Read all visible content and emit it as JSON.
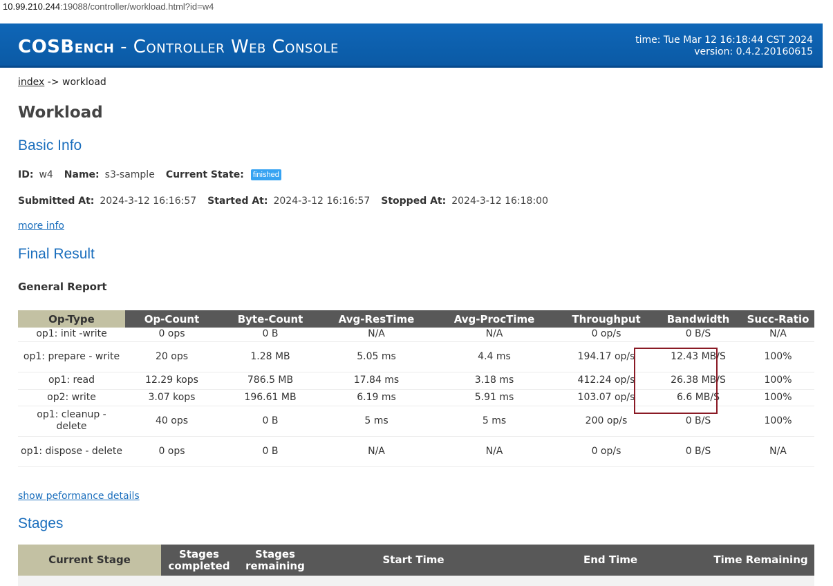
{
  "address_bar": {
    "host": "10.99.210.244",
    "rest": ":19088/controller/workload.html?id=w4"
  },
  "header": {
    "brand_bold": "COSBench",
    "brand_rest": " - Controller Web Console",
    "time": "time: Tue Mar 12 16:18:44 CST 2024",
    "version": "version: 0.4.2.20160615"
  },
  "breadcrumb": {
    "index": "index",
    "separator": " -> ",
    "current": "workload"
  },
  "page_title": "Workload",
  "basic_info": {
    "heading": "Basic Info",
    "id_label": "ID:",
    "id_value": "w4",
    "name_label": "Name:",
    "name_value": "s3-sample",
    "state_label": "Current State:",
    "state_value": "finished",
    "submitted_label": "Submitted At:",
    "submitted_value": "2024-3-12 16:16:57",
    "started_label": "Started At:",
    "started_value": "2024-3-12 16:16:57",
    "stopped_label": "Stopped At:",
    "stopped_value": "2024-3-12 16:18:00",
    "more_info": "more info"
  },
  "final_result": {
    "heading": "Final Result",
    "report_title": "General Report",
    "columns": [
      "Op-Type",
      "Op-Count",
      "Byte-Count",
      "Avg-ResTime",
      "Avg-ProcTime",
      "Throughput",
      "Bandwidth",
      "Succ-Ratio"
    ],
    "rows": [
      [
        "op1: init -write",
        "0 ops",
        "0 B",
        "N/A",
        "N/A",
        "0 op/s",
        "0 B/S",
        "N/A"
      ],
      [
        "op1: prepare - write",
        "20 ops",
        "1.28 MB",
        "5.05 ms",
        "4.4 ms",
        "194.17 op/s",
        "12.43 MB/S",
        "100%"
      ],
      [
        "op1: read",
        "12.29 kops",
        "786.5 MB",
        "17.84 ms",
        "3.18 ms",
        "412.24 op/s",
        "26.38 MB/S",
        "100%"
      ],
      [
        "op2: write",
        "3.07 kops",
        "196.61 MB",
        "6.19 ms",
        "5.91 ms",
        "103.07 op/s",
        "6.6 MB/S",
        "100%"
      ],
      [
        "op1: cleanup - delete",
        "40 ops",
        "0 B",
        "5 ms",
        "5 ms",
        "200 op/s",
        "0 B/S",
        "100%"
      ],
      [
        "op1: dispose - delete",
        "0 ops",
        "0 B",
        "N/A",
        "N/A",
        "0 op/s",
        "0 B/S",
        "N/A"
      ]
    ],
    "show_details": "show peformance details"
  },
  "stages": {
    "heading": "Stages",
    "columns": [
      "Current Stage",
      "Stages completed",
      "Stages remaining",
      "Start Time",
      "End Time",
      "Time Remaining"
    ]
  },
  "colors": {
    "header_bg": "#0f66b7",
    "link": "#1a6ebd",
    "badge": "#36a3f2",
    "table_header": "#585858",
    "first_header": "#c3c1a3",
    "highlight_box": "#8a1a25"
  }
}
